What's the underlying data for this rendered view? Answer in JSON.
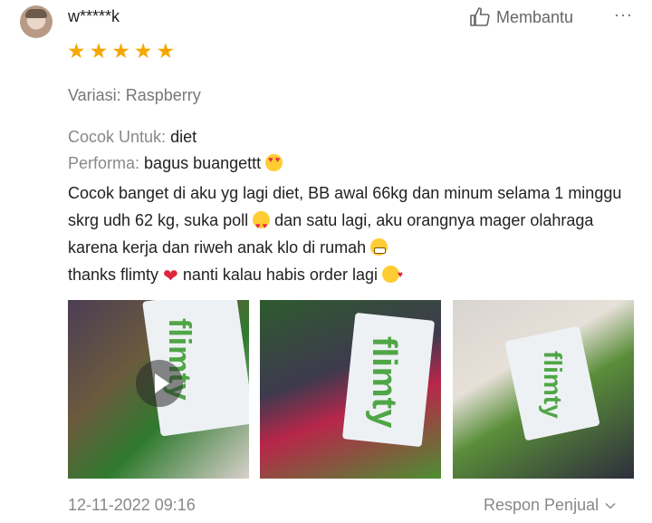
{
  "review": {
    "username": "w*****k",
    "helpful_label": "Membantu",
    "more_label": "···",
    "rating": 5,
    "variation_label": "Variasi:",
    "variation_value": "Raspberry",
    "suitable_label": "Cocok Untuk:",
    "suitable_value": "diet",
    "performance_label": "Performa:",
    "performance_value": "bagus buangettt",
    "body": {
      "seg1": "Cocok banget di aku yg lagi diet, BB awal 66kg dan minum selama 1 minggu skrg udh 62 kg, suka poll",
      "seg2": "dan satu lagi, aku orangnya mager olahraga karena kerja dan riweh anak klo di rumah",
      "seg3": "thanks flimty",
      "seg4": "nanti kalau habis order lagi"
    },
    "brand_text": "flimty",
    "date": "12-11-2022 09:16",
    "seller_response_label": "Respon Penjual"
  },
  "colors": {
    "star": "#f6a700",
    "muted": "#888888",
    "text": "#222222",
    "brand": "#4fa646"
  },
  "icons": {
    "helpful": "thumbs-up-icon",
    "more": "more-dots-icon",
    "play": "play-icon",
    "chevron": "chevron-down-icon"
  }
}
